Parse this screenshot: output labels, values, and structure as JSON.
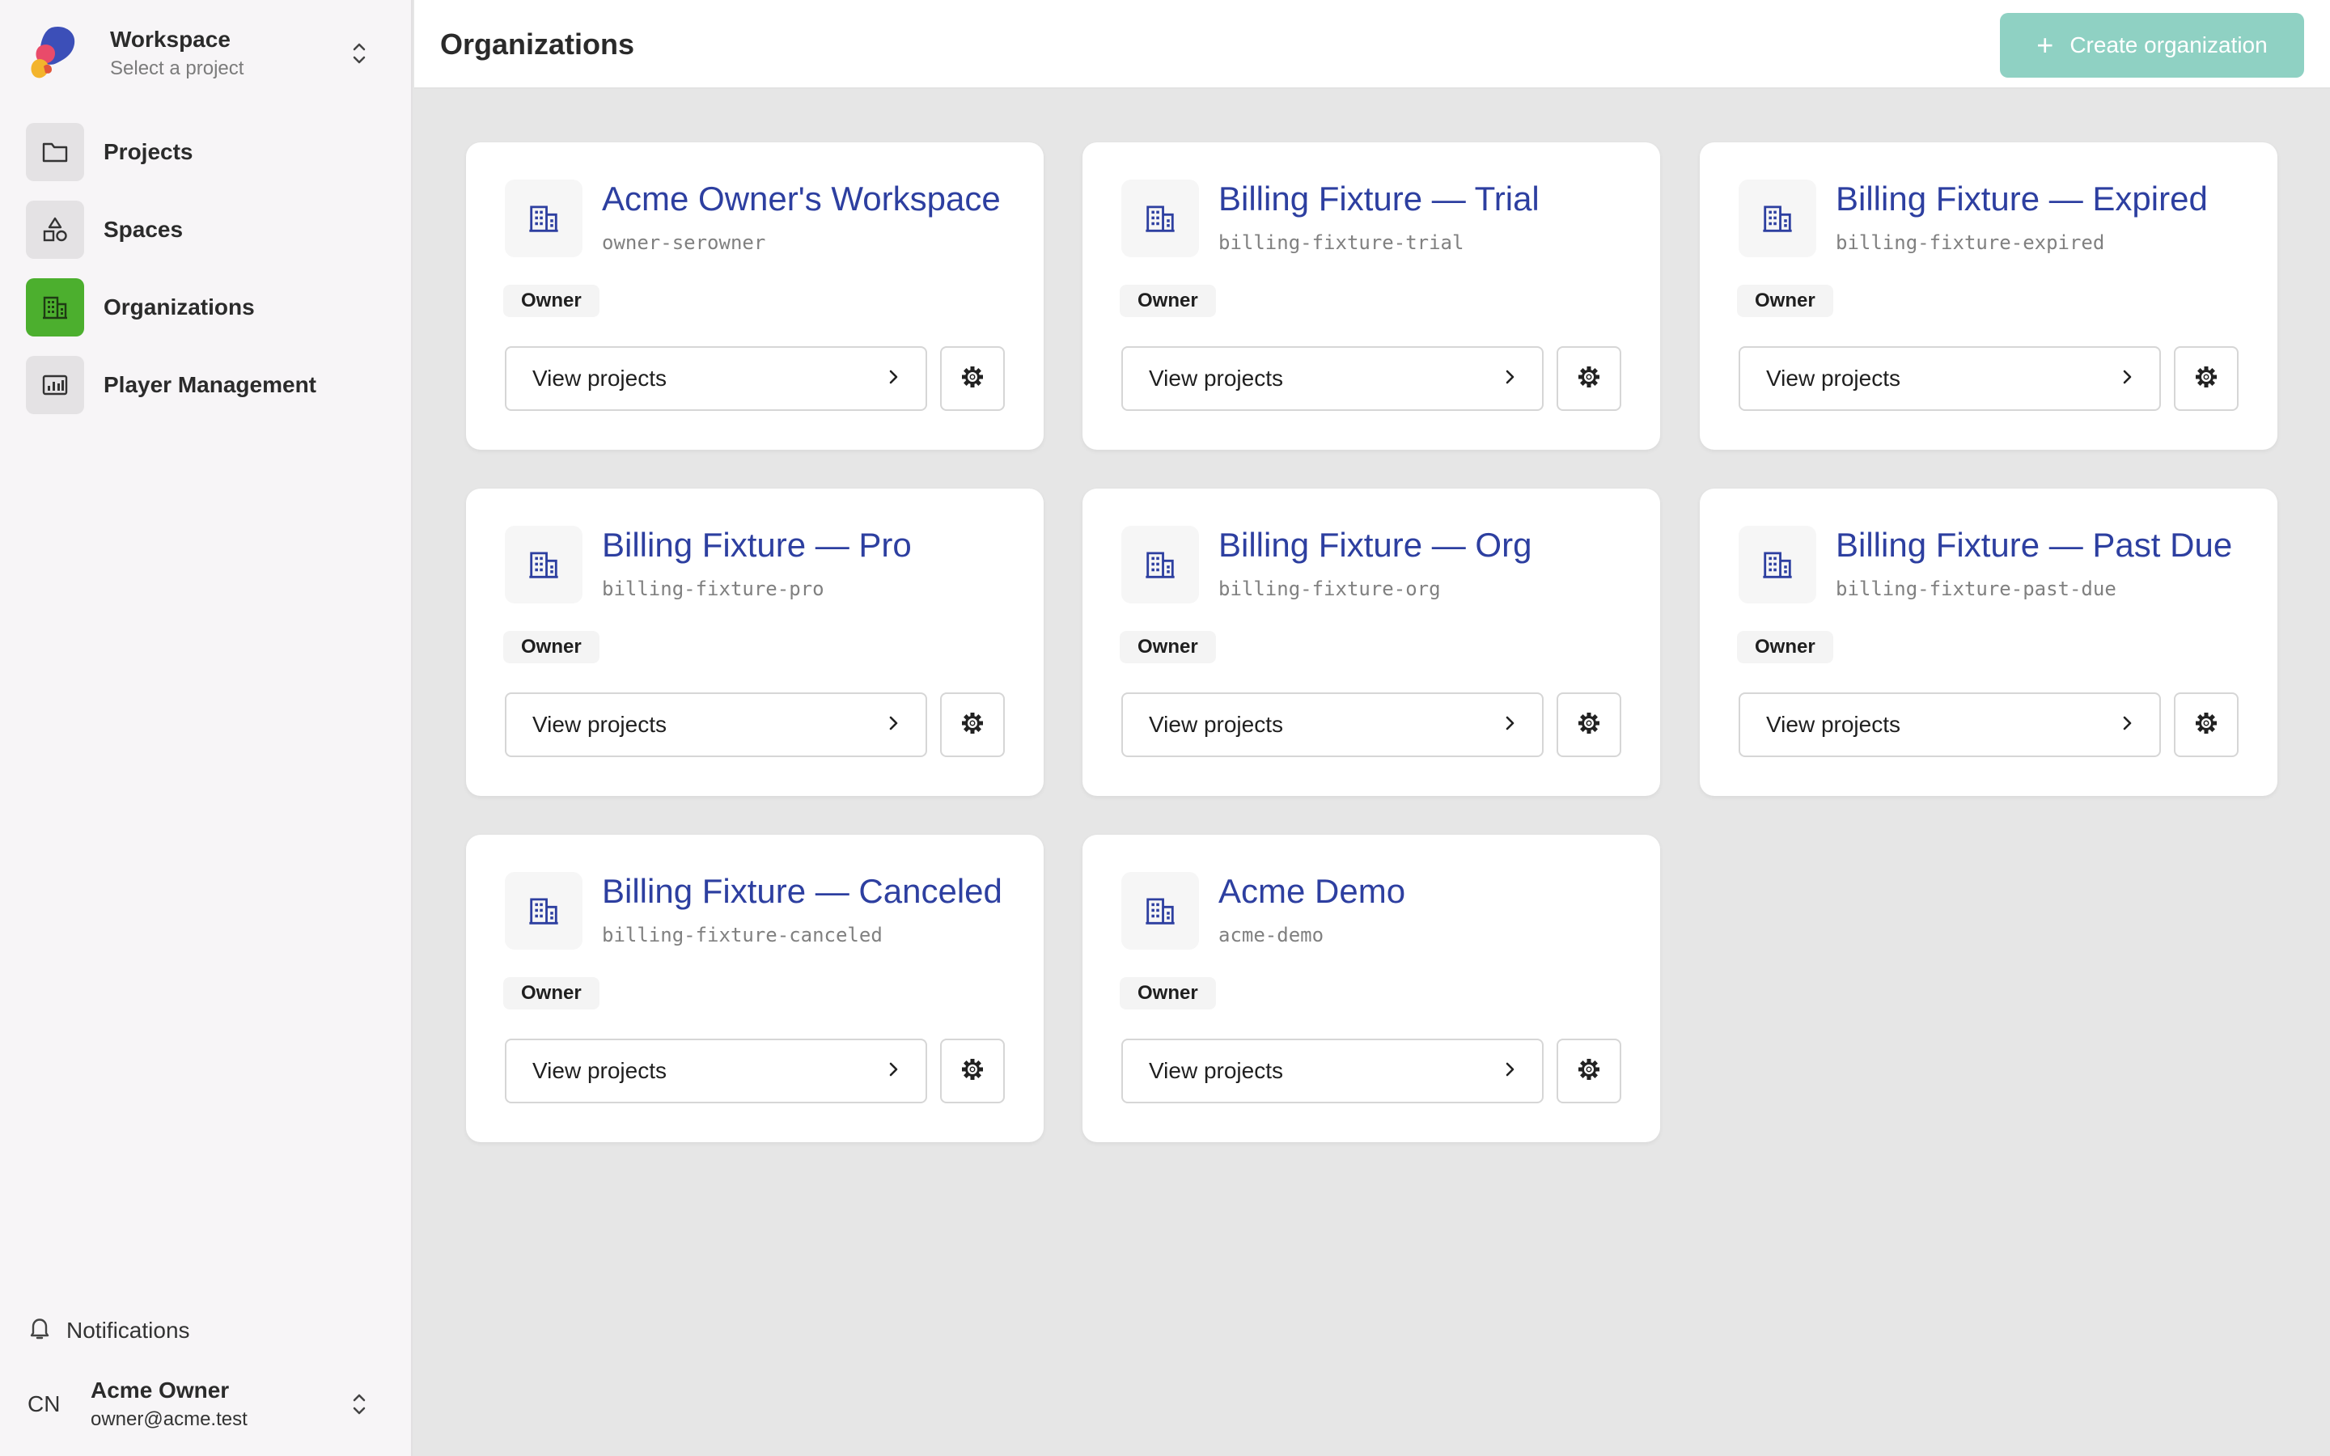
{
  "workspace": {
    "title": "Workspace",
    "subtitle": "Select a project"
  },
  "sidebar": {
    "items": [
      {
        "label": "Projects",
        "icon": "folder-icon"
      },
      {
        "label": "Spaces",
        "icon": "shapes-icon"
      },
      {
        "label": "Organizations",
        "icon": "building-icon",
        "active": true
      },
      {
        "label": "Player Management",
        "icon": "player-management-icon"
      }
    ],
    "notifications_label": "Notifications",
    "user": {
      "initials": "CN",
      "name": "Acme Owner",
      "email": "owner@acme.test"
    }
  },
  "header": {
    "title": "Organizations",
    "create_label": "Create organization",
    "create_icon": "plus-icon"
  },
  "organizations": [
    {
      "name": "Acme Owner's Workspace",
      "slug": "owner-serowner",
      "role": "Owner",
      "action": "View projects"
    },
    {
      "name": "Billing Fixture — Trial",
      "slug": "billing-fixture-trial",
      "role": "Owner",
      "action": "View projects"
    },
    {
      "name": "Billing Fixture — Expired",
      "slug": "billing-fixture-expired",
      "role": "Owner",
      "action": "View projects"
    },
    {
      "name": "Billing Fixture — Pro",
      "slug": "billing-fixture-pro",
      "role": "Owner",
      "action": "View projects"
    },
    {
      "name": "Billing Fixture — Org",
      "slug": "billing-fixture-org",
      "role": "Owner",
      "action": "View projects"
    },
    {
      "name": "Billing Fixture — Past Due",
      "slug": "billing-fixture-past-due",
      "role": "Owner",
      "action": "View projects"
    },
    {
      "name": "Billing Fixture — Canceled",
      "slug": "billing-fixture-canceled",
      "role": "Owner",
      "action": "View projects"
    },
    {
      "name": "Acme Demo",
      "slug": "acme-demo",
      "role": "Owner",
      "action": "View projects"
    }
  ],
  "colors": {
    "accent": "#4caf2e",
    "link": "#2d3fa0",
    "create_button": "#8fd1c3"
  }
}
